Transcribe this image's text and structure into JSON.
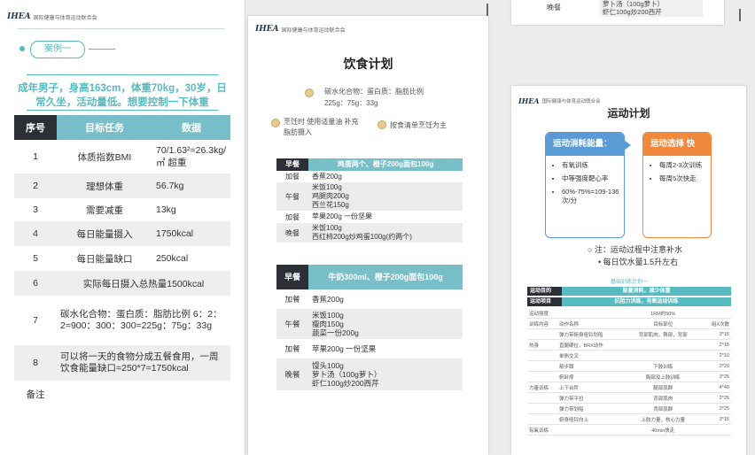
{
  "brand": {
    "logo": "IHEA",
    "org": "国际健康与体育运动联合会"
  },
  "case": {
    "tag": "案例一",
    "title": "成年男子，身高163cm，体重70kg，30岁，日常久坐，活动量低。想要控制一下体重",
    "headers": [
      "序号",
      "目标任务",
      "数据"
    ],
    "rows": [
      {
        "no": "1",
        "task": "体质指数BMI",
        "value": "70/1.63²=26.3kg/㎡ 超重"
      },
      {
        "no": "2",
        "task": "理想体重",
        "value": "56.7kg"
      },
      {
        "no": "3",
        "task": "需要减重",
        "value": "13kg"
      },
      {
        "no": "4",
        "task": "每日能量摄入",
        "value": "1750kcal"
      },
      {
        "no": "5",
        "task": "每日能量缺口",
        "value": "250kcal"
      },
      {
        "no": "6",
        "task": "实际每日摄入总热量1500kcal",
        "value": ""
      },
      {
        "no": "7",
        "task": "碳水化合物：蛋白质：脂肪比例 6：2：2=900：300：300=225g：75g：33g",
        "value": ""
      },
      {
        "no": "8",
        "task": "可以将一天的食物分成五餐食用，一周饮食能量缺口=250*7=1750kcal",
        "value": ""
      }
    ],
    "footer": "备注"
  },
  "diet": {
    "title": "饮食计划",
    "ratio_label": "碳水化合物：蛋白质：脂肪比例",
    "ratio_value": "225g：75g：33g",
    "tip1": "烹饪时 使用适量油 补充脂肪摄入",
    "tip2": "按食清单烹饪为主",
    "plan1": {
      "breakfast_label": "早餐",
      "breakfast": "鸡蛋两个、橙子200g面包100g",
      "meals": [
        {
          "label": "加餐",
          "text": "香蕉200g",
          "gray": false
        },
        {
          "label": "午餐",
          "text": "米饭100g\n鸡腿肉200g\n西兰花150g",
          "gray": true
        },
        {
          "label": "加餐",
          "text": "苹果200g 一份坚果",
          "gray": false
        },
        {
          "label": "晚餐",
          "text": "米饭100g\n西红柿200g炒鸡蛋100g(约两个)",
          "gray": true
        }
      ]
    },
    "plan2": {
      "breakfast_label": "早餐",
      "breakfast": "牛奶300ml、橙子200g面包100g",
      "meals": [
        {
          "label": "加餐",
          "text": "香蕉200g",
          "gray": false
        },
        {
          "label": "午餐",
          "text": "米饭100g\n瘦肉150g\n蔬菜一份200g",
          "gray": true
        },
        {
          "label": "加餐",
          "text": "苹果200g 一份坚果",
          "gray": false
        },
        {
          "label": "晚餐",
          "text": "馒头100g\n萝卜汤（100g萝卜）\n虾仁100g炒200西芹",
          "gray": true
        }
      ]
    }
  },
  "prev_page": {
    "label": "晚餐",
    "text": "萝卜汤（100g萝卜）\n虾仁100g炒200西芹"
  },
  "exercise": {
    "title": "运动计划",
    "box1": {
      "title": "运动消耗能量：",
      "items": [
        "有氧训练",
        "中等强度靶心率",
        "60%-75%=109-136次/分"
      ],
      "color": "#5b9bd5"
    },
    "box2": {
      "title": "运动选择 快走：",
      "items": [
        "每周2-3次训练",
        "每周5次快走"
      ],
      "color": "#f0883e"
    },
    "note1": "注：运动过程中注意补水",
    "note2": "每日饮水量1.5升左右",
    "plan_title": "基础训练计划一",
    "goal_label": "运动目的",
    "goal_value": "能量消耗，减少体重",
    "item_label": "运动项目",
    "item_value": "抗阻力训练，有氧运动训练",
    "rows": [
      [
        "运动强度",
        "",
        "1RM的50%",
        ""
      ],
      [
        "训练内容",
        "动作名称",
        "目标部位",
        "组X次数"
      ],
      [
        "",
        "弹力带俯身哑铃划船",
        "背部肌肉，臀部，背部",
        "3*15"
      ],
      [
        "热身",
        "直腿硬拉，BRX动作",
        "",
        "2*15"
      ],
      [
        "",
        "单侧交叉",
        "",
        "2*10"
      ],
      [
        "",
        "箭步蹲",
        "下肢训练",
        "3*20"
      ],
      [
        "",
        "俯卧撑",
        "胸部及上肢训练",
        "3*25"
      ],
      [
        "力量训练",
        "上下台阶",
        "腿部肌群",
        "4*40"
      ],
      [
        "",
        "弹力带平拉",
        "背部肌肉",
        "2*25"
      ],
      [
        "",
        "弹力带划船",
        "背部肌群",
        "3*25"
      ],
      [
        "",
        "俯身哑铃向上",
        "上肢力量，核心力量",
        "3*15"
      ],
      [
        "有氧训练",
        "",
        "40min快走",
        ""
      ]
    ]
  }
}
